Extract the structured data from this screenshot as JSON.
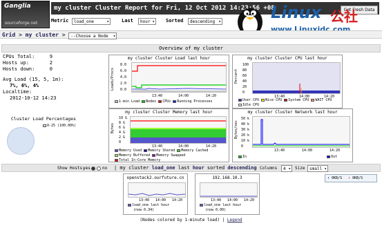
{
  "app": {
    "logo_title": "Ganglia",
    "logo_sub": "sourceforge.net",
    "report_title": "my cluster Cluster Report for Fri, 12 Oct 2012 14:23:56 +08",
    "fresh_button": "Get Fresh Data"
  },
  "controls": {
    "metric_label": "Metric",
    "metric_value": "load_one",
    "last_label": "Last",
    "last_value": "hour",
    "sorted_label": "Sorted",
    "sorted_value": "descending"
  },
  "nav": {
    "grid": "Grid",
    "sep": ">",
    "cluster": "my cluster",
    "node_select": "--Choose a Node"
  },
  "watermark": {
    "brand": "Linux",
    "cn": "公社",
    "url": "www.Linuxidc.com"
  },
  "overview": {
    "title": "Overview of my cluster",
    "stats": [
      {
        "label": "CPUs Total:",
        "value": "9"
      },
      {
        "label": "Hosts up:",
        "value": "2"
      },
      {
        "label": "Hosts down:",
        "value": "0"
      }
    ],
    "avg_load_label": "Avg Load (15, 5, 1m):",
    "avg_load_value": "7%, 6%, 4%",
    "localtime_label": "Localtime:",
    "localtime_value": "2012-10-12 14:23",
    "pie_title": "Cluster Load Percentages",
    "pie_legend": "0-25 (100.00%)"
  },
  "graphs": {
    "load": {
      "title": "my cluster Cluster Load last hour",
      "ylabel": "Loads/Procs",
      "yticks": [
        "8.0",
        "6.0",
        "4.0",
        "2.0",
        "0.0"
      ],
      "xticks": [
        "13:40",
        "14:00",
        "14:20"
      ],
      "legend": [
        "1-min Load",
        "Nodes",
        "CPUs",
        "Running Processes"
      ],
      "colors": [
        "#c9c9c9",
        "#00cc00",
        "#ff0000",
        "#2020e0"
      ]
    },
    "cpu": {
      "title": "my cluster Cluster CPU last hour",
      "ylabel": "Percent",
      "yticks": [
        "100",
        "80",
        "60",
        "40",
        "20",
        "0"
      ],
      "xticks": [
        "13:40",
        "14:00",
        "14:20"
      ],
      "legend": [
        "User CPU",
        "Nice CPU",
        "System CPU",
        "WAIT CPU",
        "Idle CPU"
      ],
      "colors": [
        "#3333bb",
        "#ffea00",
        "#dd0000",
        "#ff8a60",
        "#e2e2f2"
      ]
    },
    "memory": {
      "title": "my cluster Cluster Memory last hour",
      "ylabel": "Bytes",
      "yticks": [
        "10 G",
        "8 G",
        "6 G",
        "4 G",
        "2 G",
        "0"
      ],
      "xticks": [
        "13:40",
        "14:00",
        "14:20"
      ],
      "legend": [
        "Memory Used",
        "Memory Shared",
        "Memory Cached",
        "Memory Buffered",
        "Memory Swapped",
        "Total In-Core Memory"
      ],
      "colors": [
        "#5555cc",
        "#0000aa",
        "#33cc33",
        "#99ff33",
        "#9900aa",
        "#ff0000"
      ]
    },
    "network": {
      "title": "my cluster Cluster Network last hour",
      "ylabel": "Bytes/sec",
      "yticks": [
        "50 k",
        "40 k",
        "30 k",
        "20 k",
        "10 k",
        "0"
      ],
      "xticks": [
        "13:40",
        "14:00",
        "14:20"
      ],
      "legend": [
        "In",
        "Out"
      ],
      "colors": [
        "#00cc00",
        "#0000ff"
      ]
    }
  },
  "hostbar": {
    "show_hosts_label": "Show Hosts:",
    "yes": "yes",
    "no": "no",
    "mid_prefix": "| my cluster",
    "metric": "load_one",
    "last": "last",
    "hour": "hour",
    "sorted": "sorted",
    "order": "descending",
    "columns_label": "Columns",
    "columns_value": "4",
    "size_label": "Size",
    "size_value": "small"
  },
  "hosts": [
    {
      "name": "openstack2.ourfuture.cn",
      "metric": "load_one last hour",
      "now": "(now 0.34)",
      "xticks": [
        "13:40",
        "14:00",
        "14:20"
      ],
      "color": "#5555cc"
    },
    {
      "name": "192.168.10.3",
      "metric": "load_one last hour",
      "now": "(now 0.00)",
      "xticks": [
        "13:40",
        "14:00",
        "14:20"
      ],
      "color": "#5555cc"
    }
  ],
  "speed": [
    "0KB/S",
    "0KB/S"
  ],
  "footer": {
    "text": "(Nodes colored by 1-minute load) |",
    "legend_link": "Legend"
  }
}
